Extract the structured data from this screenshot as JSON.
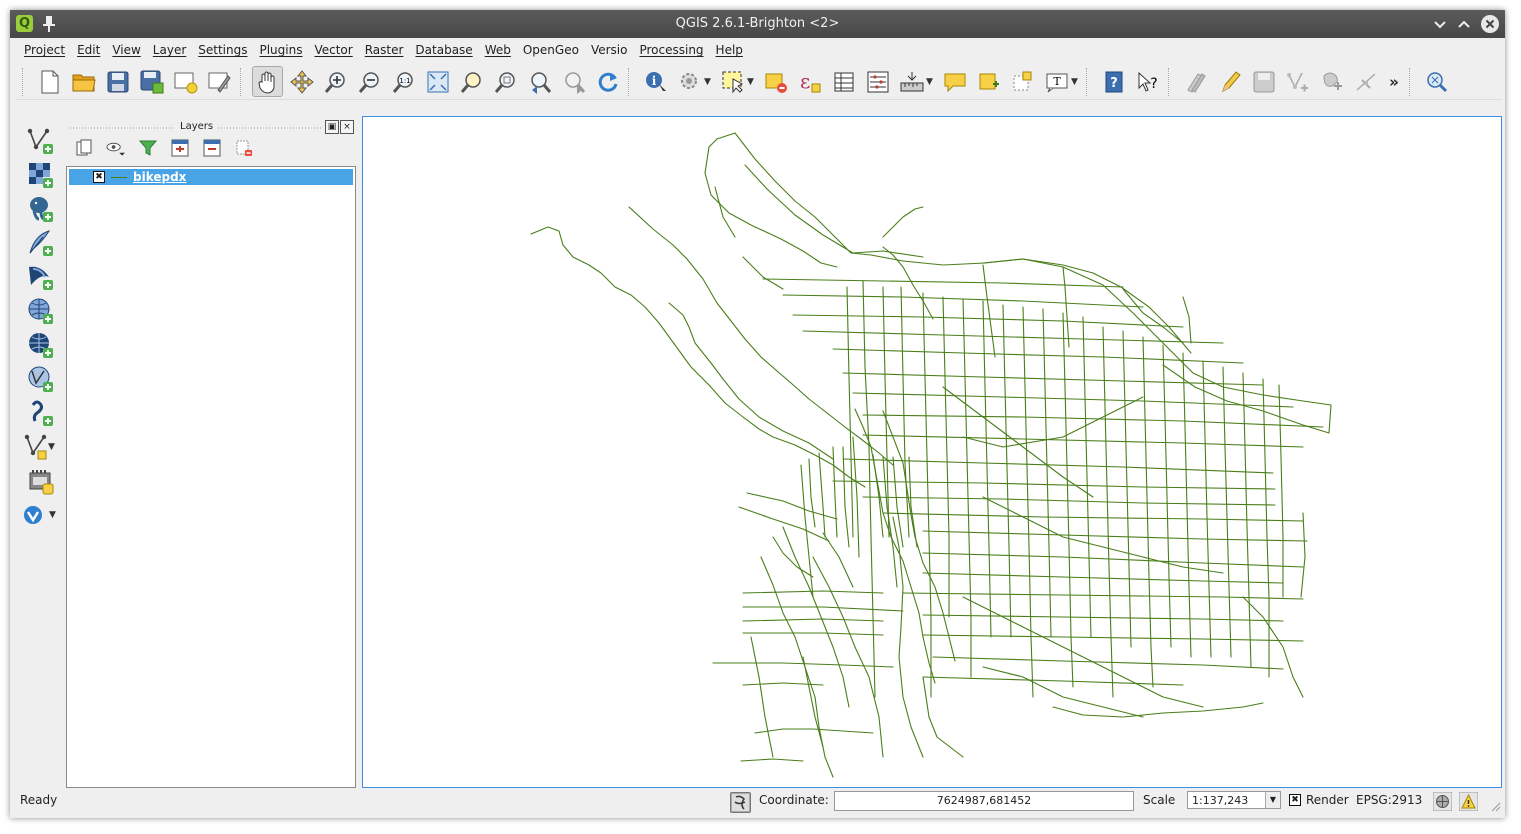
{
  "window": {
    "title": "QGIS 2.6.1-Brighton <2>"
  },
  "titlebar": {
    "icons": [
      "qgis-logo-icon",
      "pin-icon",
      "minimize-icon",
      "maximize-icon",
      "close-icon"
    ],
    "logo_letter": "Q"
  },
  "menu": [
    "Project",
    "Edit",
    "View",
    "Layer",
    "Settings",
    "Plugins",
    "Vector",
    "Raster",
    "Database",
    "Web",
    "OpenGeo",
    "Versio",
    "Processing",
    "Help"
  ],
  "toolbar": {
    "icons": [
      "new-project",
      "open-project",
      "save-project",
      "save-as",
      "new-print-composer",
      "composer-manager",
      "pan-map",
      "pan-to-selection",
      "zoom-in",
      "zoom-out",
      "zoom-actual-size",
      "zoom-full",
      "zoom-to-selection",
      "zoom-to-layer",
      "zoom-last",
      "zoom-next",
      "refresh",
      "identify-features",
      "run-feature-action",
      "select-features",
      "deselect-all",
      "select-by-expression",
      "open-attribute-table",
      "statistical-summary",
      "measure-line",
      "show-map-tips",
      "new-bookmark",
      "show-bookmarks",
      "text-annotation",
      "help-contents",
      "whats-this",
      "toggle-editing",
      "current-edits",
      "save-layer-edits",
      "add-feature",
      "move-feature",
      "node-tool",
      "more-tools",
      "georeferencer"
    ],
    "more_label": "»",
    "active_tool": "pan-map"
  },
  "side_toolbar": [
    "add-vector-layer",
    "add-raster-layer",
    "add-postgis-layer",
    "add-spatialite-layer",
    "add-mssql-layer",
    "add-wms-layer",
    "add-wcs-layer",
    "add-wfs-layer",
    "add-delimited-text-layer",
    "new-shapefile-layer",
    "add-virtual-layer",
    "versio"
  ],
  "layers_panel": {
    "title": "Layers",
    "float_glyph": "▣",
    "close_glyph": "×",
    "tools": [
      "add-group",
      "manage-visibility",
      "filter-legend",
      "expand-all",
      "collapse-all",
      "remove-layer"
    ],
    "layers": [
      {
        "name": "bikepdx",
        "checked": true,
        "check_glyph": "✖",
        "line_color": "#4a7e1a"
      }
    ]
  },
  "map": {
    "layer": "bikepdx",
    "line_color": "#4a7e1a",
    "background": "#ffffff"
  },
  "status": {
    "ready": "Ready",
    "coordinate_label": "Coordinate:",
    "coordinate_value": "7624987,681452",
    "scale_label": "Scale",
    "scale_value": "1:137,243",
    "scale_caret": "▼",
    "render_label": "Render",
    "render_checked": true,
    "render_check_glyph": "✖",
    "crs_label": "EPSG:2913"
  }
}
